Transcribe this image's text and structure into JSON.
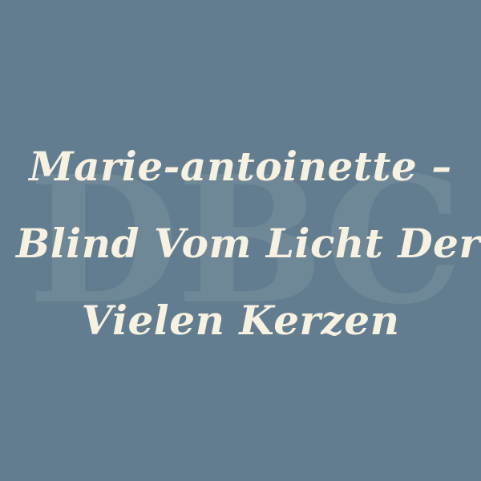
{
  "watermark": {
    "text": "DBC"
  },
  "title": {
    "lines": [
      "Marie-antoinette –",
      "Blind Vom Licht Der",
      "Vielen Kerzen"
    ]
  },
  "colors": {
    "background": "#627d8f",
    "text": "#f7f1e1"
  }
}
